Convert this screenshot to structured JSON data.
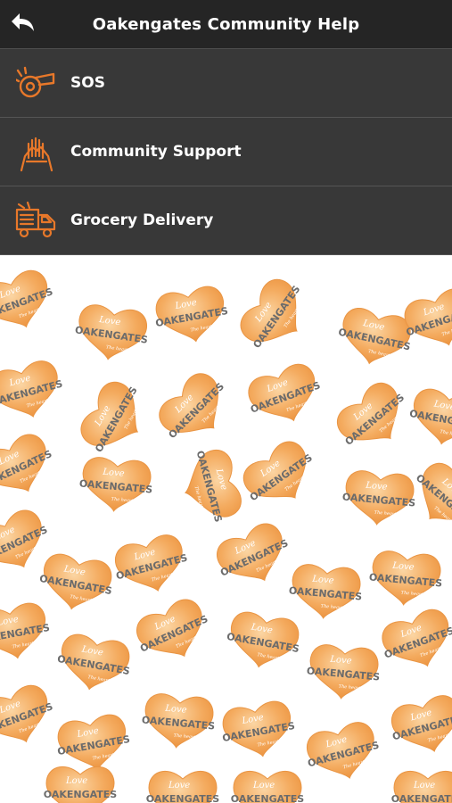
{
  "header": {
    "title": "Oakengates Community Help",
    "back_icon": "back-arrow-icon"
  },
  "menu": {
    "items": [
      {
        "label": "SOS",
        "icon": "whistle-icon"
      },
      {
        "label": "Community Support",
        "icon": "helping-hands-icon"
      },
      {
        "label": "Grocery Delivery",
        "icon": "delivery-truck-icon"
      }
    ]
  },
  "wallpaper": {
    "heart_top_text": "Love",
    "heart_main_text": "Oakengates",
    "heart_sub_text": "The heart of Telford"
  },
  "colors": {
    "header_bg": "#141414",
    "icon_orange": "#e8782a",
    "heart_orange": "#f4ab5f"
  }
}
